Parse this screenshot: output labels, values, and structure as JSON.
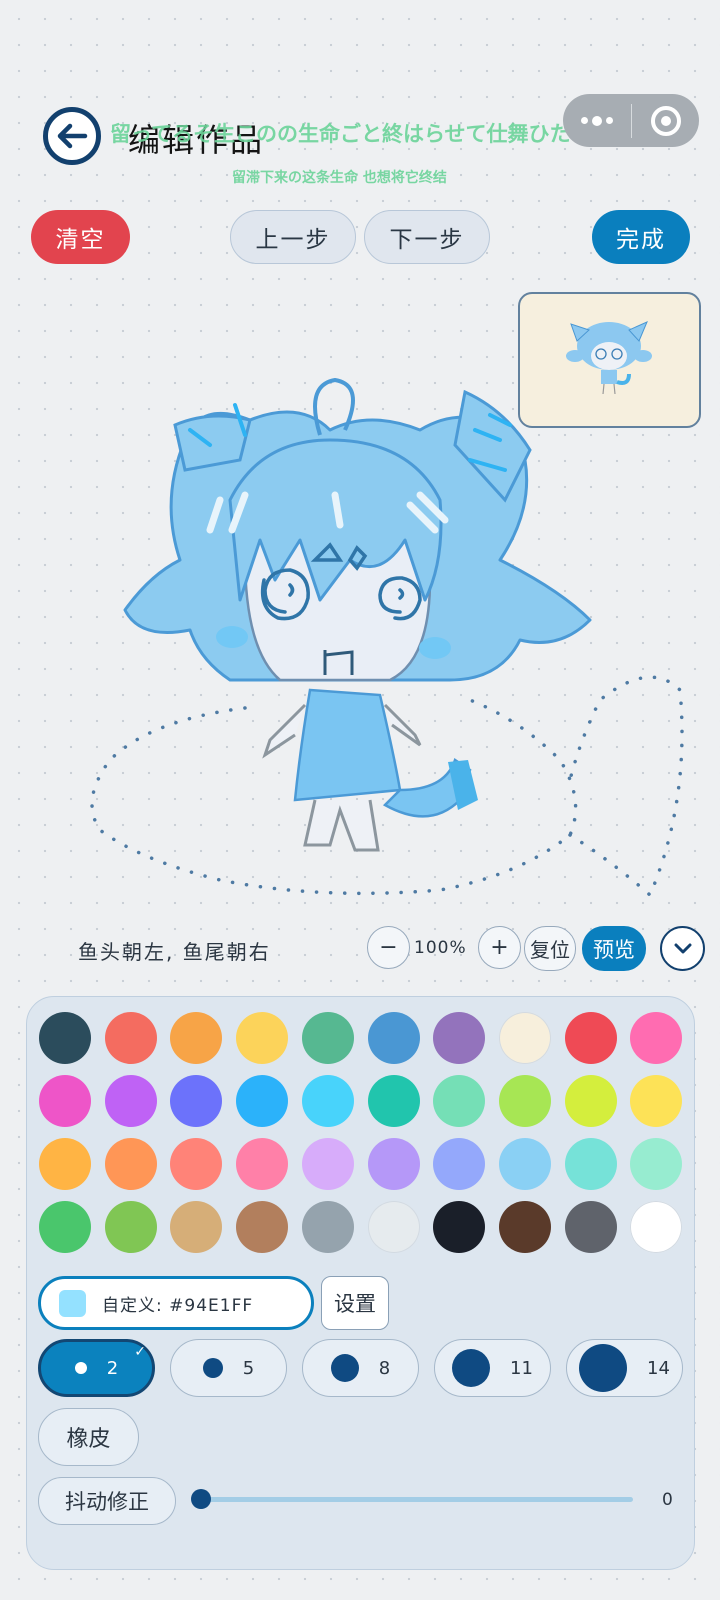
{
  "header": {
    "title": "编辑作品",
    "lyric_line1": "留ってるそ生このの生命ごと終はらせて仕舞ひたい。",
    "lyric_line2": "留滞下来の这条生命 也想将它终结"
  },
  "toolbar": {
    "clear": "清空",
    "undo": "上一步",
    "redo": "下一步",
    "done": "完成"
  },
  "canvas": {
    "hint": "鱼头朝左, 鱼尾朝右",
    "zoom_out": "−",
    "zoom_level": "100%",
    "zoom_in": "+",
    "reset": "复位",
    "preview": "预览"
  },
  "palette": {
    "colors": [
      "#2b4c5c",
      "#f46c60",
      "#f7a447",
      "#fcd35a",
      "#56b891",
      "#4a97d3",
      "#9373bc",
      "#f7efdc",
      "#ef4a55",
      "#ff6cb1",
      "#ee55c8",
      "#bf62f5",
      "#6c72fb",
      "#2bb2fa",
      "#48d3fb",
      "#21c5ad",
      "#75dfb6",
      "#a7e654",
      "#d4ee3d",
      "#fde257",
      "#ffb444",
      "#ff9656",
      "#ff8378",
      "#ff80a8",
      "#d7acfa",
      "#b598f8",
      "#94a8fb",
      "#8ad0f4",
      "#76e2d8",
      "#97ecd0",
      "#4ac66c",
      "#80c654",
      "#d6ae78",
      "#b27f5d",
      "#95a3ad",
      "#e6ebee",
      "#1a1f29",
      "#5a3a2a",
      "#5f636b",
      "#ffffff"
    ],
    "custom_label": "自定义: #94E1FF",
    "custom_color": "#94E1FF",
    "set_button": "设置",
    "brush_sizes": [
      "2",
      "5",
      "8",
      "11",
      "14"
    ],
    "selected_size": "2",
    "eraser": "橡皮",
    "stabilizer_label": "抖动修正",
    "stabilizer_value": "0",
    "stabilizer_level": 0
  }
}
